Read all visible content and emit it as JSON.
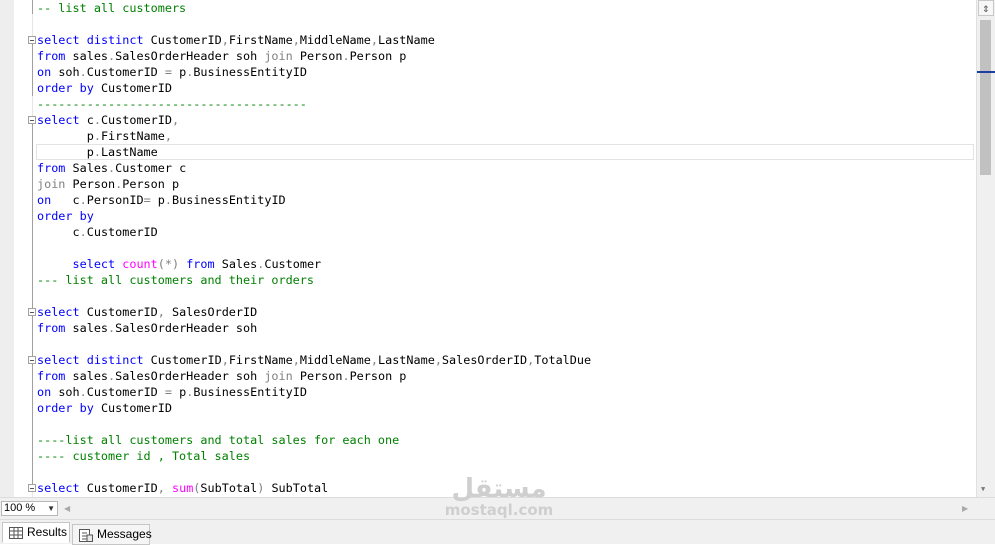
{
  "editor": {
    "lines": [
      {
        "segments": [
          {
            "c": "cm",
            "t": "-- list all customers"
          }
        ]
      },
      {
        "segments": []
      },
      {
        "segments": [
          {
            "c": "kw",
            "t": "select"
          },
          {
            "c": "",
            "t": " "
          },
          {
            "c": "kw",
            "t": "distinct"
          },
          {
            "c": "",
            "t": " CustomerID"
          },
          {
            "c": "gy",
            "t": ","
          },
          {
            "c": "",
            "t": "FirstName"
          },
          {
            "c": "gy",
            "t": ","
          },
          {
            "c": "",
            "t": "MiddleName"
          },
          {
            "c": "gy",
            "t": ","
          },
          {
            "c": "",
            "t": "LastName"
          }
        ]
      },
      {
        "segments": [
          {
            "c": "kw",
            "t": "from"
          },
          {
            "c": "",
            "t": " sales"
          },
          {
            "c": "gy",
            "t": "."
          },
          {
            "c": "",
            "t": "SalesOrderHeader soh "
          },
          {
            "c": "gy",
            "t": "join"
          },
          {
            "c": "",
            "t": " Person"
          },
          {
            "c": "gy",
            "t": "."
          },
          {
            "c": "",
            "t": "Person p"
          }
        ]
      },
      {
        "segments": [
          {
            "c": "kw",
            "t": "on"
          },
          {
            "c": "",
            "t": " soh"
          },
          {
            "c": "gy",
            "t": "."
          },
          {
            "c": "",
            "t": "CustomerID "
          },
          {
            "c": "gy",
            "t": "="
          },
          {
            "c": "",
            "t": " p"
          },
          {
            "c": "gy",
            "t": "."
          },
          {
            "c": "",
            "t": "BusinessEntityID"
          }
        ]
      },
      {
        "segments": [
          {
            "c": "kw",
            "t": "order"
          },
          {
            "c": "",
            "t": " "
          },
          {
            "c": "kw",
            "t": "by"
          },
          {
            "c": "",
            "t": " CustomerID"
          }
        ]
      },
      {
        "segments": [
          {
            "c": "cm",
            "t": "--------------------------------------"
          }
        ]
      },
      {
        "segments": [
          {
            "c": "kw",
            "t": "select"
          },
          {
            "c": "",
            "t": " c"
          },
          {
            "c": "gy",
            "t": "."
          },
          {
            "c": "",
            "t": "CustomerID"
          },
          {
            "c": "gy",
            "t": ","
          }
        ]
      },
      {
        "segments": [
          {
            "c": "",
            "t": "       p"
          },
          {
            "c": "gy",
            "t": "."
          },
          {
            "c": "",
            "t": "FirstName"
          },
          {
            "c": "gy",
            "t": ","
          }
        ]
      },
      {
        "segments": [
          {
            "c": "",
            "t": "       p"
          },
          {
            "c": "gy",
            "t": "."
          },
          {
            "c": "",
            "t": "LastName"
          }
        ]
      },
      {
        "segments": [
          {
            "c": "kw",
            "t": "from"
          },
          {
            "c": "",
            "t": " Sales"
          },
          {
            "c": "gy",
            "t": "."
          },
          {
            "c": "",
            "t": "Customer c"
          }
        ]
      },
      {
        "segments": [
          {
            "c": "gy",
            "t": "join"
          },
          {
            "c": "",
            "t": " Person"
          },
          {
            "c": "gy",
            "t": "."
          },
          {
            "c": "",
            "t": "Person p"
          }
        ]
      },
      {
        "segments": [
          {
            "c": "kw",
            "t": "on"
          },
          {
            "c": "",
            "t": "   c"
          },
          {
            "c": "gy",
            "t": "."
          },
          {
            "c": "",
            "t": "PersonID"
          },
          {
            "c": "gy",
            "t": "="
          },
          {
            "c": "",
            "t": " p"
          },
          {
            "c": "gy",
            "t": "."
          },
          {
            "c": "",
            "t": "BusinessEntityID"
          }
        ]
      },
      {
        "segments": [
          {
            "c": "kw",
            "t": "order"
          },
          {
            "c": "",
            "t": " "
          },
          {
            "c": "kw",
            "t": "by"
          }
        ]
      },
      {
        "segments": [
          {
            "c": "",
            "t": "     c"
          },
          {
            "c": "gy",
            "t": "."
          },
          {
            "c": "",
            "t": "CustomerID"
          }
        ]
      },
      {
        "segments": []
      },
      {
        "segments": [
          {
            "c": "",
            "t": "     "
          },
          {
            "c": "kw",
            "t": "select"
          },
          {
            "c": "",
            "t": " "
          },
          {
            "c": "fn",
            "t": "count"
          },
          {
            "c": "gy",
            "t": "(*)"
          },
          {
            "c": "",
            "t": " "
          },
          {
            "c": "kw",
            "t": "from"
          },
          {
            "c": "",
            "t": " Sales"
          },
          {
            "c": "gy",
            "t": "."
          },
          {
            "c": "",
            "t": "Customer"
          }
        ]
      },
      {
        "segments": [
          {
            "c": "cm",
            "t": "--- list all customers and their orders"
          }
        ]
      },
      {
        "segments": []
      },
      {
        "segments": [
          {
            "c": "kw",
            "t": "select"
          },
          {
            "c": "",
            "t": " CustomerID"
          },
          {
            "c": "gy",
            "t": ","
          },
          {
            "c": "",
            "t": " SalesOrderID"
          }
        ]
      },
      {
        "segments": [
          {
            "c": "kw",
            "t": "from"
          },
          {
            "c": "",
            "t": " sales"
          },
          {
            "c": "gy",
            "t": "."
          },
          {
            "c": "",
            "t": "SalesOrderHeader soh"
          }
        ]
      },
      {
        "segments": []
      },
      {
        "segments": [
          {
            "c": "kw",
            "t": "select"
          },
          {
            "c": "",
            "t": " "
          },
          {
            "c": "kw",
            "t": "distinct"
          },
          {
            "c": "",
            "t": " CustomerID"
          },
          {
            "c": "gy",
            "t": ","
          },
          {
            "c": "",
            "t": "FirstName"
          },
          {
            "c": "gy",
            "t": ","
          },
          {
            "c": "",
            "t": "MiddleName"
          },
          {
            "c": "gy",
            "t": ","
          },
          {
            "c": "",
            "t": "LastName"
          },
          {
            "c": "gy",
            "t": ","
          },
          {
            "c": "",
            "t": "SalesOrderID"
          },
          {
            "c": "gy",
            "t": ","
          },
          {
            "c": "",
            "t": "TotalDue"
          }
        ]
      },
      {
        "segments": [
          {
            "c": "kw",
            "t": "from"
          },
          {
            "c": "",
            "t": " sales"
          },
          {
            "c": "gy",
            "t": "."
          },
          {
            "c": "",
            "t": "SalesOrderHeader soh "
          },
          {
            "c": "gy",
            "t": "join"
          },
          {
            "c": "",
            "t": " Person"
          },
          {
            "c": "gy",
            "t": "."
          },
          {
            "c": "",
            "t": "Person p"
          }
        ]
      },
      {
        "segments": [
          {
            "c": "kw",
            "t": "on"
          },
          {
            "c": "",
            "t": " soh"
          },
          {
            "c": "gy",
            "t": "."
          },
          {
            "c": "",
            "t": "CustomerID "
          },
          {
            "c": "gy",
            "t": "="
          },
          {
            "c": "",
            "t": " p"
          },
          {
            "c": "gy",
            "t": "."
          },
          {
            "c": "",
            "t": "BusinessEntityID"
          }
        ]
      },
      {
        "segments": [
          {
            "c": "kw",
            "t": "order"
          },
          {
            "c": "",
            "t": " "
          },
          {
            "c": "kw",
            "t": "by"
          },
          {
            "c": "",
            "t": " CustomerID"
          }
        ]
      },
      {
        "segments": []
      },
      {
        "segments": [
          {
            "c": "cm",
            "t": "----list all customers and total sales for each one"
          }
        ]
      },
      {
        "segments": [
          {
            "c": "cm",
            "t": "---- customer id , Total sales"
          }
        ]
      },
      {
        "segments": []
      },
      {
        "segments": [
          {
            "c": "kw",
            "t": "select"
          },
          {
            "c": "",
            "t": " CustomerID"
          },
          {
            "c": "gy",
            "t": ","
          },
          {
            "c": "",
            "t": " "
          },
          {
            "c": "fn",
            "t": "sum"
          },
          {
            "c": "gy",
            "t": "("
          },
          {
            "c": "",
            "t": "SubTotal"
          },
          {
            "c": "gy",
            "t": ")"
          },
          {
            "c": "",
            "t": " SubTotal"
          }
        ]
      }
    ]
  },
  "status": {
    "zoom_value": "100 %"
  },
  "tabs": {
    "results_label": "Results",
    "messages_label": "Messages"
  },
  "watermark": {
    "arabic": "مستقل",
    "latin": "mostaql.com"
  },
  "icons": {
    "split": "split-view-icon",
    "results": "grid-table-icon",
    "messages": "messages-icon"
  },
  "colors": {
    "keyword": "#0000ff",
    "comment": "#008000",
    "operator": "#808080",
    "function": "#ff00ff"
  }
}
